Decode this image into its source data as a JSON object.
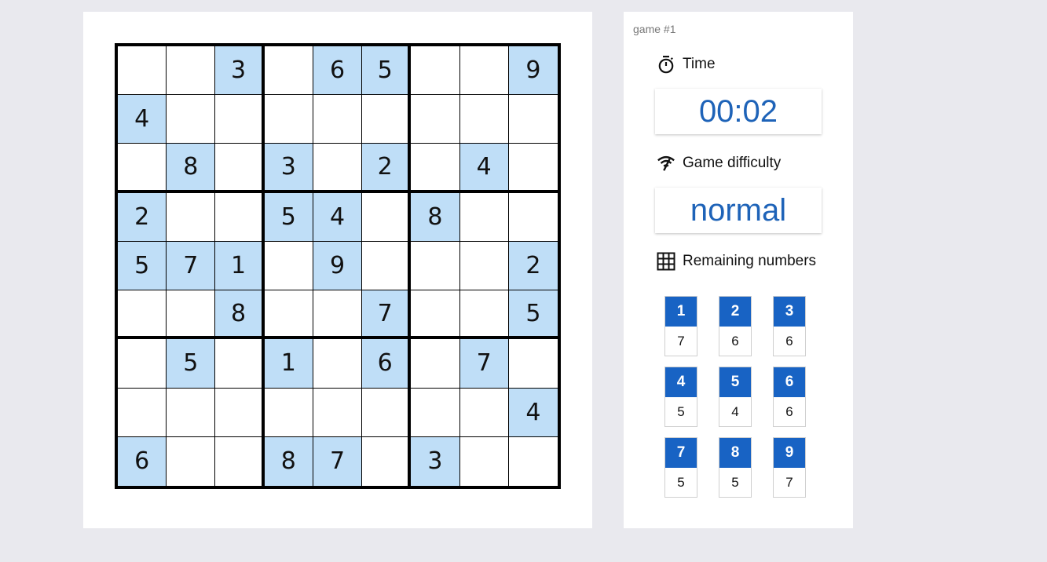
{
  "game": {
    "label": "game #1"
  },
  "time": {
    "label": "Time",
    "value": "00:02",
    "icon": "stopwatch-icon"
  },
  "difficulty": {
    "label": "Game difficulty",
    "value": "normal",
    "icon": "signal-icon"
  },
  "remaining": {
    "label": "Remaining numbers",
    "icon": "grid-icon",
    "items": [
      {
        "digit": "1",
        "count": "7"
      },
      {
        "digit": "2",
        "count": "6"
      },
      {
        "digit": "3",
        "count": "6"
      },
      {
        "digit": "4",
        "count": "5"
      },
      {
        "digit": "5",
        "count": "4"
      },
      {
        "digit": "6",
        "count": "6"
      },
      {
        "digit": "7",
        "count": "5"
      },
      {
        "digit": "8",
        "count": "5"
      },
      {
        "digit": "9",
        "count": "7"
      }
    ]
  },
  "colors": {
    "given_cell": "#bfdef7",
    "accent": "#1863c4",
    "value_text": "#1e63b8"
  },
  "board": [
    [
      "",
      "",
      "3",
      "",
      "6",
      "5",
      "",
      "",
      "9"
    ],
    [
      "4",
      "",
      "",
      "",
      "",
      "",
      "",
      "",
      ""
    ],
    [
      "",
      "8",
      "",
      "3",
      "",
      "2",
      "",
      "4",
      ""
    ],
    [
      "2",
      "",
      "",
      "5",
      "4",
      "",
      "8",
      "",
      ""
    ],
    [
      "5",
      "7",
      "1",
      "",
      "9",
      "",
      "",
      "",
      "2"
    ],
    [
      "",
      "",
      "8",
      "",
      "",
      "7",
      "",
      "",
      "5"
    ],
    [
      "",
      "5",
      "",
      "1",
      "",
      "6",
      "",
      "7",
      ""
    ],
    [
      "",
      "",
      "",
      "",
      "",
      "",
      "",
      "",
      "4"
    ],
    [
      "6",
      "",
      "",
      "8",
      "7",
      "",
      "3",
      "",
      ""
    ]
  ]
}
